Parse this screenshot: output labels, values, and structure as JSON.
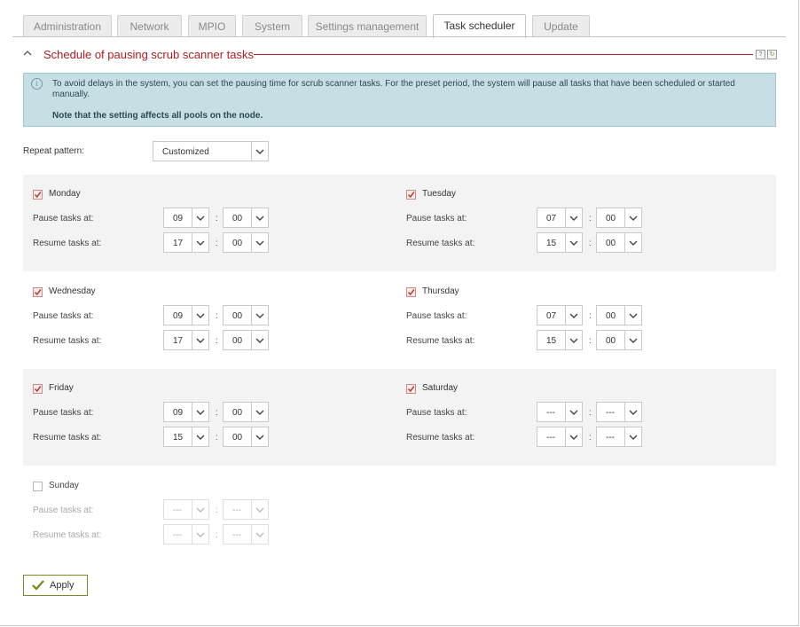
{
  "tabs": [
    "Administration",
    "Network",
    "MPIO",
    "System",
    "Settings management",
    "Task scheduler",
    "Update"
  ],
  "active_tab": "Task scheduler",
  "section": {
    "title": "Schedule of pausing scrub scanner tasks",
    "help_icon": "help-icon",
    "refresh_icon": "refresh-icon"
  },
  "info": {
    "icon": "info-icon",
    "text": "To avoid delays in the system, you can set the pausing time for scrub scanner tasks. For the preset period, the system will pause all tasks that have been scheduled or started manually.",
    "note": "Note that the setting affects all pools on the node."
  },
  "repeat_pattern": {
    "label": "Repeat pattern:",
    "value": "Customized"
  },
  "labels": {
    "pause": "Pause tasks at:",
    "resume": "Resume tasks at:",
    "sep": ":"
  },
  "days": [
    {
      "name": "Monday",
      "checked": true,
      "pause_h": "09",
      "pause_m": "00",
      "resume_h": "17",
      "resume_m": "00"
    },
    {
      "name": "Tuesday",
      "checked": true,
      "pause_h": "07",
      "pause_m": "00",
      "resume_h": "15",
      "resume_m": "00"
    },
    {
      "name": "Wednesday",
      "checked": true,
      "pause_h": "09",
      "pause_m": "00",
      "resume_h": "17",
      "resume_m": "00"
    },
    {
      "name": "Thursday",
      "checked": true,
      "pause_h": "07",
      "pause_m": "00",
      "resume_h": "15",
      "resume_m": "00"
    },
    {
      "name": "Friday",
      "checked": true,
      "pause_h": "09",
      "pause_m": "00",
      "resume_h": "15",
      "resume_m": "00"
    },
    {
      "name": "Saturday",
      "checked": true,
      "pause_h": "---",
      "pause_m": "---",
      "resume_h": "---",
      "resume_m": "---"
    },
    {
      "name": "Sunday",
      "checked": false,
      "pause_h": "---",
      "pause_m": "---",
      "resume_h": "---",
      "resume_m": "---"
    }
  ],
  "apply_label": "Apply",
  "colors": {
    "accent": "#b01c22",
    "info_bg": "#c6dfe4",
    "apply_border": "#7a8a2a",
    "check": "#c0392b"
  }
}
